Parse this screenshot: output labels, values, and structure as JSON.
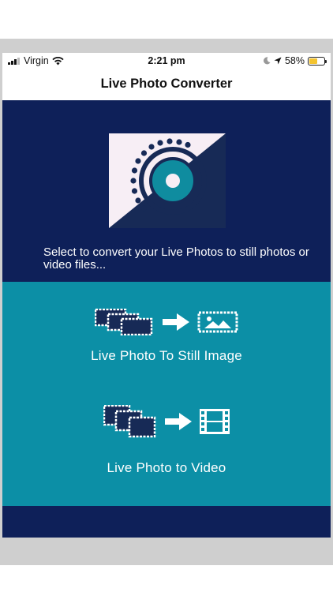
{
  "status_bar": {
    "carrier": "Virgin",
    "time": "2:21 pm",
    "battery_percent": "58%",
    "battery_level": 0.58
  },
  "app": {
    "title": "Live Photo Converter"
  },
  "header": {
    "tagline": "Select to convert your Live Photos to still photos or video files..."
  },
  "options": [
    {
      "label": "Live Photo To Still Image",
      "target_icon": "still-image-icon"
    },
    {
      "label": "Live Photo to Video",
      "target_icon": "film-strip-icon"
    }
  ],
  "colors": {
    "navy": "#0e2059",
    "teal": "#0c8fa6",
    "logo_light": "#f7eef5",
    "logo_teal": "#0f8c9f",
    "battery": "#f4c430"
  }
}
